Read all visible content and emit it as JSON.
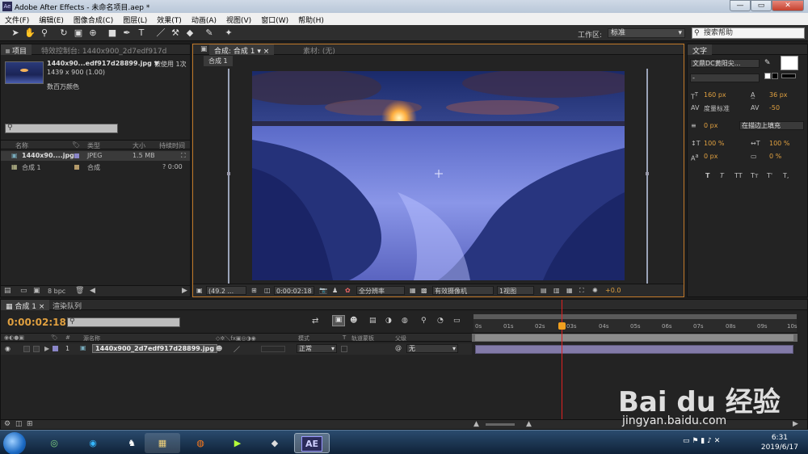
{
  "window": {
    "title": "Adobe After Effects - 未命名项目.aep *",
    "app_icon_label": "Ae"
  },
  "menu": [
    "文件(F)",
    "编辑(E)",
    "图像合成(C)",
    "图层(L)",
    "效果(T)",
    "动画(A)",
    "视图(V)",
    "窗口(W)",
    "帮助(H)"
  ],
  "toolbar": {
    "workspace_label": "工作区:",
    "workspace_value": "标准",
    "help_search": "搜索帮助"
  },
  "project": {
    "tabs": [
      "项目",
      "特效控制台: 1440x900_2d7edf917d"
    ],
    "selected_name": "1440x90...edf917d28899.jpg ▼",
    "used_count": "被使用 1次",
    "dimensions": "1439 x 900 (1.00)",
    "color_desc": "数百万颜色",
    "columns": [
      "名称",
      "类型",
      "大小",
      "持续时间"
    ],
    "items": [
      {
        "name": "1440x90....jpg",
        "type": "JPEG",
        "size": "1.5 MB",
        "duration": "",
        "color": "#8a86c8"
      },
      {
        "name": "合成 1",
        "type": "合成",
        "size": "",
        "duration": "? 0:00",
        "color": "#b49a6a"
      }
    ],
    "bpc": "8 bpc"
  },
  "viewer": {
    "tabs": [
      "合成: 合成 1",
      "素材: (无)"
    ],
    "subtab": "合成 1",
    "zoom": "(49.2 ...",
    "time": "0:00:02:18",
    "resolution": "全分辨率",
    "camera": "有效摄像机",
    "views": "1视图",
    "exposure": "+0.0"
  },
  "character": {
    "title": "文字",
    "font": "文鼎DC黄阳尖...",
    "style": "-",
    "size": "160 px",
    "leading": "36 px",
    "kerning": "度量标准",
    "tracking": "-50",
    "stroke": "0 px",
    "stroke_mode": "在描边上填充",
    "vscale": "100 %",
    "hscale": "100 %",
    "baseline": "0 px",
    "tsume": "0 %",
    "styles": [
      "T",
      "T",
      "TT",
      "Tт",
      "T'",
      "T,"
    ]
  },
  "timeline": {
    "tabs": [
      "合成 1",
      "渲染队列"
    ],
    "timecode": "0:00:02:18",
    "columns": [
      "源名称",
      "模式",
      "T",
      "轨道蒙板",
      "父级"
    ],
    "layer": {
      "index": "1",
      "name": "1440x900_2d7edf917d28899.jpg",
      "mode": "正常",
      "parent": "无"
    },
    "ruler": [
      "0s",
      "01s",
      "02s",
      "03s",
      "04s",
      "05s",
      "06s",
      "07s",
      "08s",
      "09s",
      "10s"
    ]
  },
  "taskbar": {
    "time": "6:31",
    "date": "2019/6/17",
    "active_app": "AE"
  },
  "watermark": {
    "brand": "Bai du 经验",
    "url": "jingyan.baidu.com"
  }
}
